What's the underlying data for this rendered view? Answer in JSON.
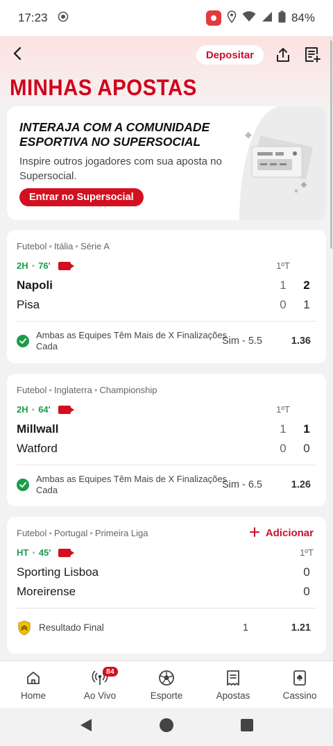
{
  "status_bar": {
    "time": "17:23",
    "battery": "84%"
  },
  "header": {
    "deposit_label": "Depositar",
    "title": "MINHAS APOSTAS"
  },
  "promo": {
    "heading": "INTERAJA COM A COMUNIDADE ESPORTIVA NO SUPERSOCIAL",
    "text": "Inspire outros jogadores com sua aposta no Supersocial.",
    "button": "Entrar no Supersocial"
  },
  "bets": [
    {
      "league": [
        "Futebol",
        "Itália",
        "Série A"
      ],
      "status": "2H",
      "minute": "76'",
      "period_label": "1ºT",
      "home": {
        "name": "Napoli",
        "p1": "1",
        "total": "2"
      },
      "away": {
        "name": "Pisa",
        "p1": "0",
        "total": "1"
      },
      "market": "Ambas as Equipes Têm Mais de X Finalizações Cada",
      "selection": "Sim - 5.5",
      "odds": "1.36"
    },
    {
      "league": [
        "Futebol",
        "Inglaterra",
        "Championship"
      ],
      "status": "2H",
      "minute": "64'",
      "period_label": "1ºT",
      "home": {
        "name": "Millwall",
        "p1": "1",
        "total": "1"
      },
      "away": {
        "name": "Watford",
        "p1": "0",
        "total": "0"
      },
      "market": "Ambas as Equipes Têm Mais de X Finalizações Cada",
      "selection": "Sim - 6.5",
      "odds": "1.26"
    },
    {
      "league": [
        "Futebol",
        "Portugal",
        "Primeira Liga"
      ],
      "add_label": "Adicionar",
      "status": "HT",
      "minute": "45'",
      "period_label": "1ºT",
      "home": {
        "name": "Sporting Lisboa",
        "total": "0"
      },
      "away": {
        "name": "Moreirense",
        "total": "0"
      },
      "market": "Resultado Final",
      "selection": "1",
      "odds": "1.21"
    }
  ],
  "bottom_nav": [
    {
      "label": "Home",
      "icon": "home-icon"
    },
    {
      "label": "Ao Vivo",
      "icon": "live-broadcast-icon",
      "badge": "84"
    },
    {
      "label": "Esporte",
      "icon": "soccer-ball-icon"
    },
    {
      "label": "Apostas",
      "icon": "bet-slip-icon"
    },
    {
      "label": "Cassino",
      "icon": "card-icon"
    }
  ],
  "colors": {
    "brand_red": "#d0021b",
    "live_green": "#1a9c4b"
  }
}
